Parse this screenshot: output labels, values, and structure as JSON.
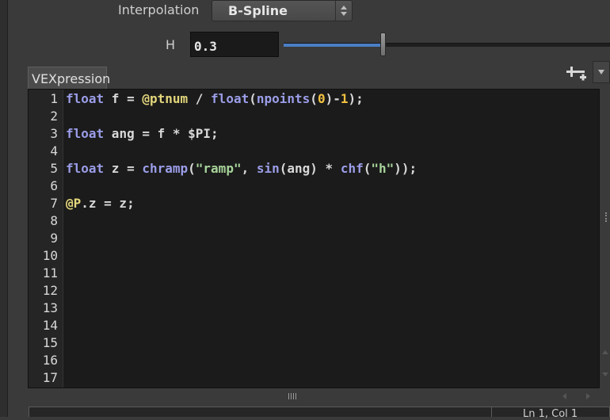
{
  "parameters": {
    "interpolation": {
      "label": "Interpolation",
      "value": "B-Spline"
    },
    "h": {
      "label": "H",
      "value": "0.3",
      "slider_fraction": 0.3
    }
  },
  "editor": {
    "label": "VEXpression",
    "line_numbers": [
      "1",
      "2",
      "3",
      "4",
      "5",
      "6",
      "7",
      "8",
      "9",
      "10",
      "11",
      "12",
      "13",
      "14",
      "15",
      "16",
      "17"
    ],
    "lines": [
      "float f = @ptnum / float(npoints(0)-1);",
      "",
      "float ang = f * $PI;",
      "",
      "float z = chramp(\"ramp\", sin(ang) * chf(\"h\"));",
      "",
      "@P.z = z;"
    ],
    "icons": {
      "add": "add-parameter-icon",
      "menu": "chevron-down-icon"
    }
  },
  "status": {
    "position": "Ln 1, Col 1"
  },
  "colors": {
    "keyword": "#9b9de8",
    "attribute": "#e3d67c",
    "number": "#f0c040",
    "string": "#a7d49a",
    "slider_fill": "#4a7fc4"
  }
}
